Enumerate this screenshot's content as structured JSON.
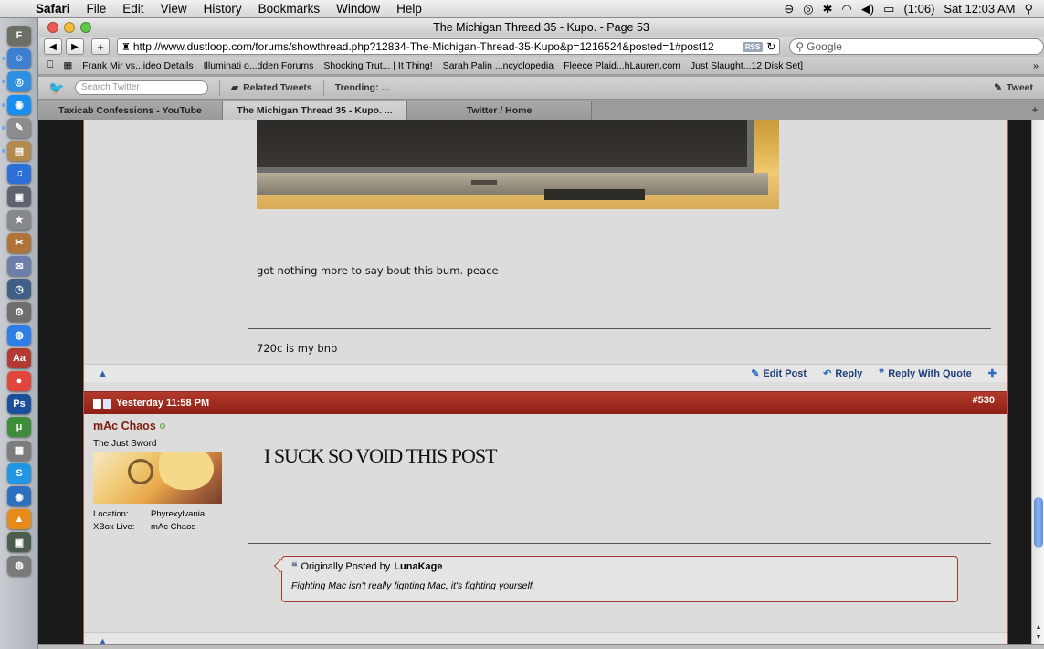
{
  "menubar": {
    "app": "Safari",
    "items": [
      "File",
      "Edit",
      "View",
      "History",
      "Bookmarks",
      "Window",
      "Help"
    ],
    "battery": "(1:06)",
    "clock": "Sat 12:03 AM"
  },
  "window": {
    "title": "The Michigan Thread 35 - Kupo. - Page 53"
  },
  "toolbar": {
    "back": "◀",
    "forward": "▶",
    "add": "+",
    "url": "http://www.dustloop.com/forums/showthread.php?12834-The-Michigan-Thread-35-Kupo&p=1216524&posted=1#post12",
    "rss": "RSS",
    "search_placeholder": "Google"
  },
  "bookmarks": {
    "items": [
      "Frank Mir vs...ideo Details",
      "Illuminati o...dden Forums",
      "Shocking Trut... | It Thing!",
      "Sarah Palin ...ncyclopedia",
      "Fleece Plaid...hLauren.com",
      "Just Slaught...12 Disk Set]"
    ]
  },
  "twitter": {
    "search_placeholder": "Search Twitter",
    "related": "Related Tweets",
    "trending": "Trending: ...",
    "tweet": "Tweet"
  },
  "tabs": [
    "Taxicab Confessions - YouTube",
    "The Michigan Thread 35 - Kupo. ...",
    "Twitter / Home"
  ],
  "post_529": {
    "text": "got nothing more to say bout this bum. peace",
    "signature": "720c is my bnb",
    "actions": {
      "edit": "Edit Post",
      "reply": "Reply",
      "reply_quote": "Reply With Quote"
    }
  },
  "post_530": {
    "date": "Yesterday 11:58 PM",
    "number": "#530",
    "username": "mAc Chaos",
    "user_title": "The Just Sword",
    "location_label": "Location:",
    "location": "Phyrexylvania",
    "xbox_label": "XBox Live:",
    "xbox": "mAc Chaos",
    "message": "I SUCK SO VOID THIS POST",
    "quote": {
      "prefix": "Originally Posted by",
      "author": "LunaKage",
      "text": "Fighting Mac isn't really fighting Mac, it's fighting yourself."
    }
  },
  "dock_icons": [
    {
      "glyph": "F",
      "color": "#6b6f66"
    },
    {
      "glyph": "☺",
      "color": "#3e7fd0"
    },
    {
      "glyph": "◎",
      "color": "#2f8fe0"
    },
    {
      "glyph": "◉",
      "color": "#1a8df0"
    },
    {
      "glyph": "✎",
      "color": "#8c8c8c"
    },
    {
      "glyph": "▤",
      "color": "#b28a4e"
    },
    {
      "glyph": "♫",
      "color": "#2c6fd6"
    },
    {
      "glyph": "▣",
      "color": "#5d6470"
    },
    {
      "glyph": "★",
      "color": "#86898c"
    },
    {
      "glyph": "✂",
      "color": "#b0743a"
    },
    {
      "glyph": "✉",
      "color": "#6b7faa"
    },
    {
      "glyph": "◷",
      "color": "#3f5f86"
    },
    {
      "glyph": "⚙",
      "color": "#6e6e6e"
    },
    {
      "glyph": "◍",
      "color": "#2f7ee8"
    },
    {
      "glyph": "Aa",
      "color": "#b23a32"
    },
    {
      "glyph": "●",
      "color": "#e2453c"
    },
    {
      "glyph": "Ps",
      "color": "#1b4f9b"
    },
    {
      "glyph": "μ",
      "color": "#3e8d3a"
    },
    {
      "glyph": "▦",
      "color": "#7c7c7c"
    },
    {
      "glyph": "S",
      "color": "#2196e3"
    },
    {
      "glyph": "◉",
      "color": "#2f6fbf"
    },
    {
      "glyph": "▲",
      "color": "#e68a1a"
    },
    {
      "glyph": "▣",
      "color": "#4d5d4d"
    },
    {
      "glyph": "◍",
      "color": "#7a7a7a"
    }
  ]
}
